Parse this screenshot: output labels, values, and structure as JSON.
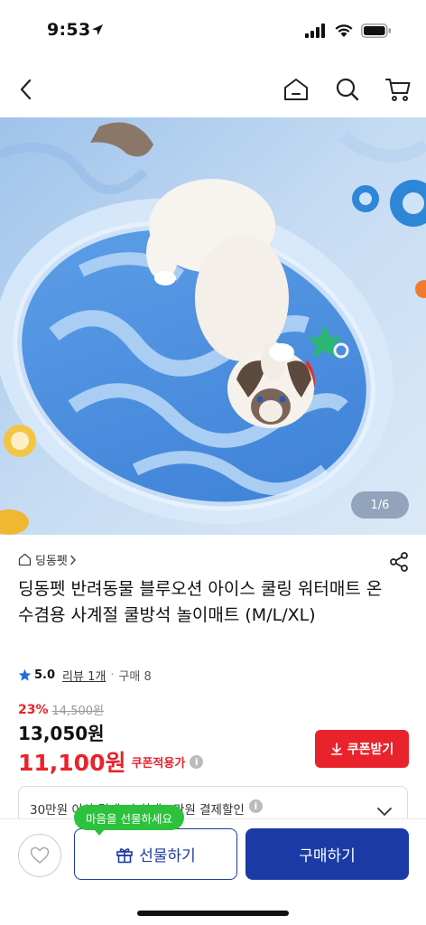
{
  "status_bar": {
    "time": "9:53"
  },
  "product": {
    "image_counter": "1/6",
    "store_name": "딩동펫",
    "title": "딩동펫 반려동물 블루오션 아이스 쿨링 워터매트 온수겸용 사계절 쿨방석 놀이매트 (M/L/XL)",
    "rating": "5.0",
    "review_text": "리뷰 1개",
    "purchase_text": "구매 8"
  },
  "price": {
    "discount_pct": "23%",
    "original": "14,500원",
    "sale": "13,050원",
    "coupon_price": "11,100원",
    "coupon_label": "쿠폰적용가"
  },
  "coupon_button": {
    "label": "쿠폰받기"
  },
  "promo": {
    "text": "30만원 이상 결제 시 최대 1만원 결제할인"
  },
  "bottom_bar": {
    "gift_tooltip": "마음을 선물하세요",
    "gift_label": "선물하기",
    "buy_label": "구매하기"
  },
  "colors": {
    "accent_red": "#e8232b",
    "primary_blue": "#1a3aa6",
    "tooltip_green": "#2cc23c",
    "star_blue": "#1e6fd9"
  },
  "icons": [
    "location-arrow-icon",
    "signal-icon",
    "wifi-icon",
    "battery-icon",
    "back-icon",
    "home-icon",
    "search-icon",
    "cart-icon",
    "store-home-icon",
    "chevron-right-icon",
    "share-icon",
    "star-icon",
    "info-icon",
    "download-icon",
    "chevron-down-icon",
    "heart-icon",
    "gift-icon"
  ]
}
